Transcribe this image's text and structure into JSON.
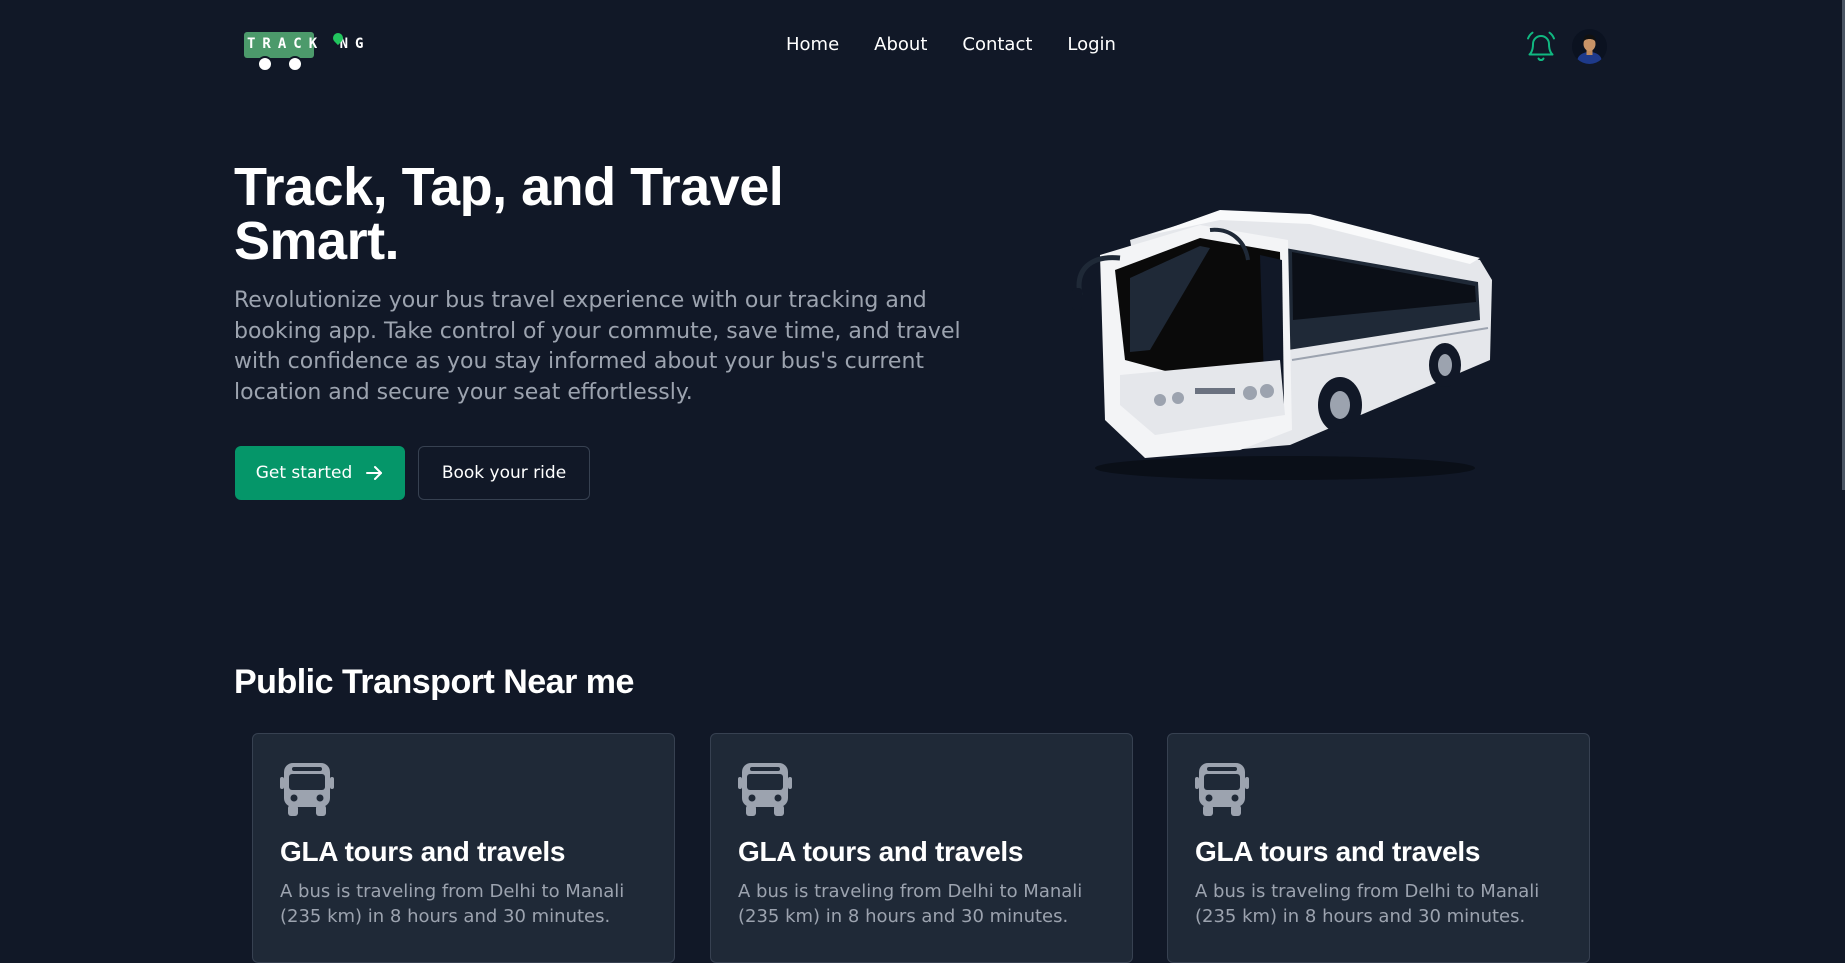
{
  "brand": {
    "logo_text": "TRACKING",
    "logo_visible_text": "TRACK NG",
    "colors": {
      "accent": "#059669",
      "logo_green": "#4c9a6b",
      "background": "#111827",
      "card": "#1f2937"
    }
  },
  "nav": {
    "items": [
      {
        "label": "Home"
      },
      {
        "label": "About"
      },
      {
        "label": "Contact"
      },
      {
        "label": "Login"
      }
    ]
  },
  "header_actions": {
    "notification_icon": "bell-icon",
    "avatar": "user-avatar"
  },
  "hero": {
    "title": "Track, Tap, and Travel Smart.",
    "description": "Revolutionize your bus travel experience with our tracking and booking app. Take control of your commute, save time, and travel with confidence as you stay informed about your bus's current location and secure your seat effortlessly.",
    "primary_button": "Get started",
    "primary_button_icon": "arrow-right-icon",
    "secondary_button": "Book your ride",
    "image": "bus-image"
  },
  "transport": {
    "title": "Public Transport Near me",
    "cards": [
      {
        "icon": "bus-icon",
        "title": "GLA tours and travels",
        "description": "A bus is traveling from Delhi to Manali (235 km) in 8 hours and 30 minutes."
      },
      {
        "icon": "bus-icon",
        "title": "GLA tours and travels",
        "description": "A bus is traveling from Delhi to Manali (235 km) in 8 hours and 30 minutes."
      },
      {
        "icon": "bus-icon",
        "title": "GLA tours and travels",
        "description": "A bus is traveling from Delhi to Manali (235 km) in 8 hours and 30 minutes."
      }
    ]
  }
}
